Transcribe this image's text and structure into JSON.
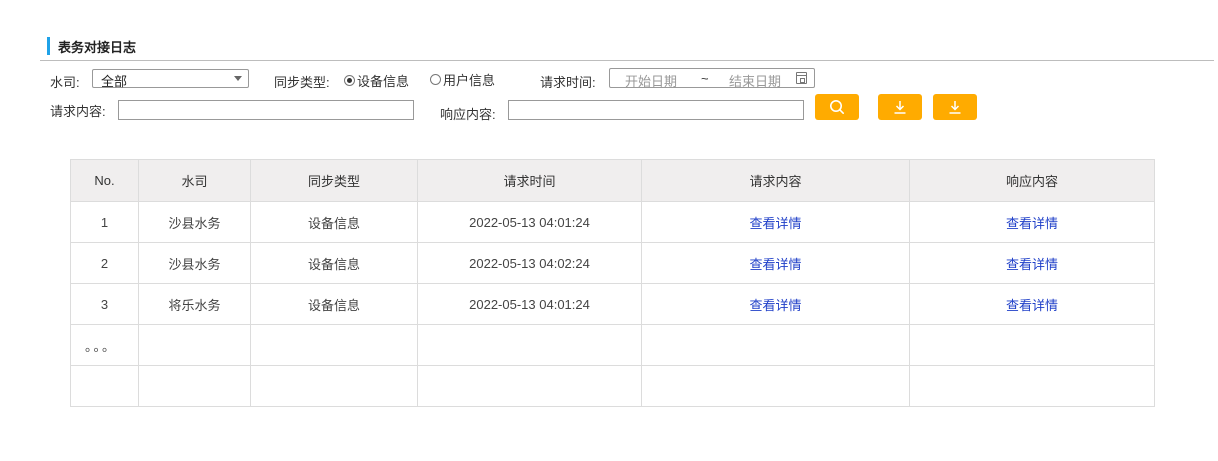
{
  "section": {
    "title": "表务对接日志"
  },
  "filters": {
    "water_company_label": "水司:",
    "water_company_value": "全部",
    "sync_type_label": "同步类型:",
    "sync_options": [
      {
        "label": "设备信息",
        "selected": true
      },
      {
        "label": "用户信息",
        "selected": false
      }
    ],
    "request_time_label": "请求时间:",
    "start_date_placeholder": "开始日期",
    "date_separator": "~",
    "end_date_placeholder": "结束日期",
    "request_content_label": "请求内容:",
    "request_content_value": "",
    "response_content_label": "响应内容:",
    "response_content_value": ""
  },
  "buttons": {
    "search_icon": "search-icon",
    "download_icon": "download-icon",
    "accent_color": "#ffab00"
  },
  "table": {
    "columns": [
      "No.",
      "水司",
      "同步类型",
      "请求时间",
      "请求内容",
      "响应内容"
    ],
    "rows": [
      {
        "no": "1",
        "company": "沙县水务",
        "type": "设备信息",
        "time": "2022-05-13 04:01:24",
        "request": "查看详情",
        "response": "查看详情"
      },
      {
        "no": "2",
        "company": "沙县水务",
        "type": "设备信息",
        "time": "2022-05-13 04:02:24",
        "request": "查看详情",
        "response": "查看详情"
      },
      {
        "no": "3",
        "company": "将乐水务",
        "type": "设备信息",
        "time": "2022-05-13 04:01:24",
        "request": "查看详情",
        "response": "查看详情"
      }
    ],
    "ellipsis": "。。。",
    "link_color": "#1f3fc8",
    "header_bg": "#f0eeee"
  }
}
